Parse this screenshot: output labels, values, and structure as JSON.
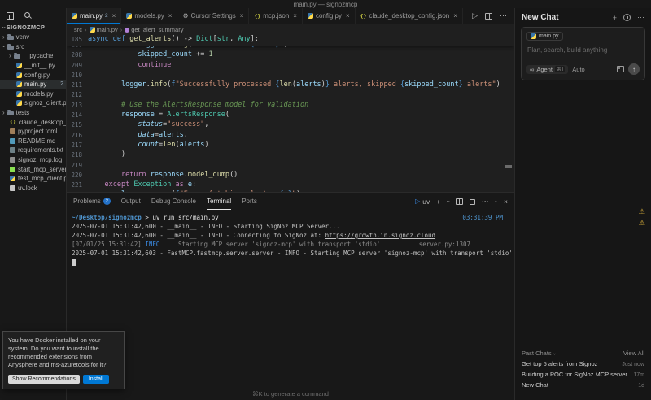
{
  "window": {
    "title": "main.py — signozmcp"
  },
  "colors": {
    "accent_blue": "#0078d4",
    "badge_blue": "#2472c8",
    "warning_yellow": "#e2b73d",
    "selection_bg": "#2a2d2e"
  },
  "sidebar": {
    "root": "SIGNOZMCP",
    "items": [
      {
        "label": "venv",
        "icon": "folder",
        "indent": 0,
        "chevron": ">"
      },
      {
        "label": "src",
        "icon": "folder",
        "indent": 0,
        "chevron": "v"
      },
      {
        "label": "__pycache__",
        "icon": "folder",
        "indent": 1,
        "chevron": ">"
      },
      {
        "label": "__init__.py",
        "icon": "python",
        "indent": 1
      },
      {
        "label": "config.py",
        "icon": "python",
        "indent": 1
      },
      {
        "label": "main.py",
        "icon": "python",
        "indent": 1,
        "badge": "2",
        "selected": true
      },
      {
        "label": "models.py",
        "icon": "python",
        "indent": 1
      },
      {
        "label": "signoz_client.py",
        "icon": "python",
        "indent": 1
      },
      {
        "label": "tests",
        "icon": "folder",
        "indent": 0,
        "chevron": ">"
      },
      {
        "label": "claude_desktop_con...",
        "icon": "json",
        "indent": 0
      },
      {
        "label": "pyproject.toml",
        "icon": "toml",
        "indent": 0
      },
      {
        "label": "README.md",
        "icon": "md",
        "indent": 0
      },
      {
        "label": "requirements.txt",
        "icon": "txt",
        "indent": 0
      },
      {
        "label": "signoz_mcp.log",
        "icon": "log",
        "indent": 0
      },
      {
        "label": "start_mcp_server.sh",
        "icon": "sh",
        "indent": 0
      },
      {
        "label": "test_mcp_client.py",
        "icon": "python",
        "indent": 0
      },
      {
        "label": "uv.lock",
        "icon": "lock",
        "indent": 0
      }
    ]
  },
  "tabs": {
    "items": [
      {
        "label": "main.py",
        "icon": "python",
        "badge": "2",
        "active": true
      },
      {
        "label": "models.py",
        "icon": "python"
      },
      {
        "label": "Cursor Settings",
        "icon": "gear"
      },
      {
        "label": "mcp.json",
        "icon": "json"
      },
      {
        "label": "config.py",
        "icon": "python"
      },
      {
        "label": "claude_desktop_config.json",
        "icon": "json"
      }
    ]
  },
  "breadcrumb": {
    "items": [
      {
        "label": "src"
      },
      {
        "label": "main.py",
        "icon": "python"
      },
      {
        "label": "get_alert_summary",
        "icon": "symbol-method"
      }
    ]
  },
  "editor": {
    "sticky": {
      "num": 185,
      "tokens": [
        [
          "async def ",
          "kw"
        ],
        [
          "get_alerts",
          "fn"
        ],
        [
          "() -> ",
          "pl"
        ],
        [
          "Dict",
          "ty"
        ],
        [
          "[",
          "pl"
        ],
        [
          "str",
          "ty"
        ],
        [
          ", ",
          "pl"
        ],
        [
          "Any",
          "ty"
        ],
        [
          "]:",
          "pl"
        ]
      ]
    },
    "lines": [
      {
        "num": 207,
        "tokens": [
          [
            "            ",
            "pl"
          ],
          [
            "logger",
            "va"
          ],
          [
            ".",
            "pl"
          ],
          [
            "debug",
            "fn"
          ],
          [
            "(",
            "pl"
          ],
          [
            "f",
            "kw"
          ],
          [
            "\"Alert data: ",
            "st"
          ],
          [
            "{",
            "fb"
          ],
          [
            "alert",
            "va"
          ],
          [
            "}",
            "fb"
          ],
          [
            "\"",
            "st"
          ],
          [
            ")",
            "pl"
          ]
        ]
      },
      {
        "num": 208,
        "tokens": [
          [
            "            ",
            "pl"
          ],
          [
            "skipped_count",
            "va"
          ],
          [
            " += ",
            "pl"
          ],
          [
            "1",
            "nu"
          ]
        ]
      },
      {
        "num": 209,
        "tokens": [
          [
            "            ",
            "pl"
          ],
          [
            "continue",
            "kwc"
          ]
        ]
      },
      {
        "num": 210,
        "tokens": []
      },
      {
        "num": 211,
        "tokens": [
          [
            "        ",
            "pl"
          ],
          [
            "logger",
            "va"
          ],
          [
            ".",
            "pl"
          ],
          [
            "info",
            "fn"
          ],
          [
            "(",
            "pl"
          ],
          [
            "f",
            "kw"
          ],
          [
            "\"Successfully processed ",
            "st"
          ],
          [
            "{",
            "fb"
          ],
          [
            "len",
            "fn"
          ],
          [
            "(",
            "pl"
          ],
          [
            "alerts",
            "va"
          ],
          [
            ")",
            "pl"
          ],
          [
            "}",
            "fb"
          ],
          [
            " alerts, skipped ",
            "st"
          ],
          [
            "{",
            "fb"
          ],
          [
            "skipped_count",
            "va"
          ],
          [
            "}",
            "fb"
          ],
          [
            " alerts\"",
            "st"
          ],
          [
            ")",
            "pl"
          ]
        ]
      },
      {
        "num": 212,
        "tokens": []
      },
      {
        "num": 213,
        "tokens": [
          [
            "        ",
            "pl"
          ],
          [
            "# Use the AlertsResponse model for validation",
            "cm"
          ]
        ]
      },
      {
        "num": 214,
        "tokens": [
          [
            "        ",
            "pl"
          ],
          [
            "response",
            "va"
          ],
          [
            " = ",
            "pl"
          ],
          [
            "AlertsResponse",
            "ty"
          ],
          [
            "(",
            "pl"
          ]
        ]
      },
      {
        "num": 215,
        "tokens": [
          [
            "            ",
            "pl"
          ],
          [
            "status",
            "pr"
          ],
          [
            "=",
            "pl"
          ],
          [
            "\"success\"",
            "st"
          ],
          [
            ",",
            "pl"
          ]
        ]
      },
      {
        "num": 216,
        "tokens": [
          [
            "            ",
            "pl"
          ],
          [
            "data",
            "pr"
          ],
          [
            "=",
            "pl"
          ],
          [
            "alerts",
            "va"
          ],
          [
            ",",
            "pl"
          ]
        ]
      },
      {
        "num": 217,
        "tokens": [
          [
            "            ",
            "pl"
          ],
          [
            "count",
            "pr"
          ],
          [
            "=",
            "pl"
          ],
          [
            "len",
            "fn"
          ],
          [
            "(",
            "pl"
          ],
          [
            "alerts",
            "va"
          ],
          [
            ")",
            "pl"
          ]
        ]
      },
      {
        "num": 218,
        "tokens": [
          [
            "        ",
            "pl"
          ],
          [
            ")",
            "pl"
          ]
        ]
      },
      {
        "num": 219,
        "tokens": []
      },
      {
        "num": 220,
        "tokens": [
          [
            "        ",
            "pl"
          ],
          [
            "return",
            "kwc"
          ],
          [
            " ",
            "pl"
          ],
          [
            "response",
            "va"
          ],
          [
            ".",
            "pl"
          ],
          [
            "model_dump",
            "fn"
          ],
          [
            "()",
            "pl"
          ]
        ]
      },
      {
        "num": 221,
        "tokens": [
          [
            "    ",
            "pl"
          ],
          [
            "except",
            "kwc"
          ],
          [
            " ",
            "pl"
          ],
          [
            "Exception",
            "ty"
          ],
          [
            " ",
            "pl"
          ],
          [
            "as",
            "kwc"
          ],
          [
            " ",
            "pl"
          ],
          [
            "e",
            "va"
          ],
          [
            ":",
            "pl"
          ]
        ]
      },
      {
        "num": 222,
        "tokens": [
          [
            "        ",
            "pl"
          ],
          [
            "logger",
            "va"
          ],
          [
            ".",
            "pl"
          ],
          [
            "error",
            "fn"
          ],
          [
            "(",
            "pl"
          ],
          [
            "f",
            "kw"
          ],
          [
            "\"Error fetching alerts: ",
            "st"
          ],
          [
            "{",
            "fb"
          ],
          [
            "e",
            "va"
          ],
          [
            "}",
            "fb"
          ],
          [
            "\"",
            "st"
          ],
          [
            ")",
            "pl"
          ]
        ]
      }
    ]
  },
  "panel": {
    "tabs": [
      {
        "label": "Problems",
        "badge": "2"
      },
      {
        "label": "Output"
      },
      {
        "label": "Debug Console"
      },
      {
        "label": "Terminal",
        "active": true
      },
      {
        "label": "Ports"
      }
    ],
    "terminal_title": "uv",
    "hint": "⌘K to generate a command"
  },
  "terminal": {
    "lines": [
      {
        "tokens": [
          [
            "~/Desktop/signozmcp",
            "tpath"
          ],
          [
            " ",
            "tlog"
          ],
          [
            "> ",
            "tmark"
          ],
          [
            "uv run src/main.py",
            "tcmd"
          ]
        ],
        "right": {
          "text": "03:31:39 PM",
          "color": "ttime",
          "offset": 8
        }
      },
      {
        "tokens": [
          [
            "2025-07-01 15:31:42,600 - __main__ - INFO - Starting SigNoz MCP Server...",
            "tlog"
          ]
        ]
      },
      {
        "tokens": [
          [
            "2025-07-01 15:31:42,600 - __main__ - INFO - Connecting to SigNoz at: ",
            "tlog"
          ],
          [
            "https://growth.in.signoz.cloud",
            "turl"
          ]
        ]
      },
      {
        "tokens": [
          [
            "[07/01/25 15:31:42] ",
            "tdim"
          ],
          [
            "INFO",
            "tinfo"
          ],
          [
            "     Starting MCP server 'signoz-mcp' with transport 'stdio'",
            "tdim"
          ]
        ],
        "right": {
          "text": "server.py:1307",
          "color": "tdim",
          "offset": 48
        }
      },
      {
        "tokens": [
          [
            "2025-07-01 15:31:42,603 - FastMCP.fastmcp.server.server - INFO - Starting MCP server 'signoz-mcp' with transport 'stdio'",
            "tlog"
          ]
        ]
      },
      {
        "cursor": true
      }
    ]
  },
  "chat": {
    "title": "New Chat",
    "context_chip": "main.py",
    "placeholder": "Plan, search, build anything",
    "agent_label": "Agent",
    "agent_kbd": "⌘I",
    "model_label": "Auto",
    "past": {
      "header": "Past Chats",
      "view_all": "View All",
      "items": [
        {
          "title": "Get top 5 alerts from Signoz",
          "time": "Just now"
        },
        {
          "title": "Building a POC for SigNoz MCP server",
          "time": "17m"
        },
        {
          "title": "New Chat",
          "time": "1d"
        }
      ]
    }
  },
  "toast": {
    "message": "You have Docker installed on your system. Do you want to install the recommended extensions from Anysphere and ms-azuretools for it?",
    "buttons": [
      {
        "label": "Show Recommendations",
        "style": "secondary"
      },
      {
        "label": "Install",
        "style": "primary"
      }
    ]
  }
}
